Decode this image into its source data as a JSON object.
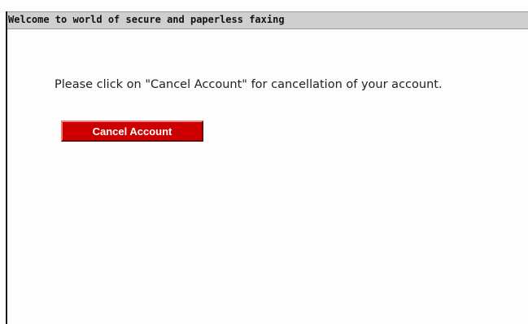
{
  "header": {
    "title": "Welcome to world of secure and paperless faxing"
  },
  "main": {
    "instruction": "Please click on \"Cancel Account\" for cancellation of your account.",
    "cancel_button_label": "Cancel Account"
  },
  "colors": {
    "header_bg": "#cfcfcf",
    "button_bg": "#cc0000",
    "button_text": "#ffffff"
  }
}
